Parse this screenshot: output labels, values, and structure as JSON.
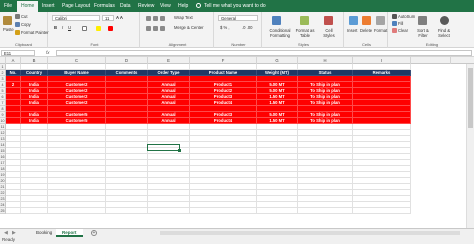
{
  "menu": {
    "tabs": [
      "File",
      "Home",
      "Insert",
      "Page Layout",
      "Formulas",
      "Data",
      "Review",
      "View",
      "Help"
    ],
    "active_index": 1,
    "tell_me": "Tell me what you want to do"
  },
  "ribbon": {
    "clipboard": {
      "paste": "Paste",
      "cut": "Cut",
      "copy": "Copy",
      "format_painter": "Format Painter",
      "label": "Clipboard"
    },
    "font": {
      "name": "Calibri",
      "size": "11",
      "label": "Font"
    },
    "alignment": {
      "wrap": "Wrap Text",
      "merge": "Merge & Center",
      "label": "Alignment"
    },
    "number": {
      "format": "General",
      "label": "Number"
    },
    "styles": {
      "conditional": "Conditional Formatting",
      "format_as": "Format as Table",
      "cell_styles": "Cell Styles",
      "label": "Styles"
    },
    "cells": {
      "insert": "Insert",
      "delete": "Delete",
      "format": "Format",
      "label": "Cells"
    },
    "editing": {
      "autosum": "AutoSum",
      "fill": "Fill",
      "clear": "Clear",
      "sort": "Sort & Filter",
      "find": "Find & Select",
      "label": "Editing"
    }
  },
  "formula_bar": {
    "name_box": "E11",
    "fx": "fx",
    "value": ""
  },
  "columns": [
    "A",
    "B",
    "C",
    "D",
    "E",
    "F",
    "G",
    "H",
    "I"
  ],
  "row_numbers": [
    "1",
    "2",
    "3",
    "4",
    "5",
    "6",
    "7",
    "8",
    "9",
    "10",
    "11",
    "12",
    "13",
    "14",
    "15",
    "16",
    "17",
    "18",
    "19",
    "20",
    "21",
    "22",
    "23",
    "24",
    "25"
  ],
  "table": {
    "headers": [
      "No.",
      "Country",
      "Buyer Name",
      "Comments",
      "Order Type",
      "Product Name",
      "Weight (MT)",
      "Status",
      "Remarks"
    ],
    "rows": [
      [
        "2",
        "India",
        "Customer2",
        "",
        "Annual",
        "Product1",
        "5.00 MT",
        "To Ship in plan",
        ""
      ],
      [
        "",
        "India",
        "Customer2",
        "",
        "Annual",
        "Product2",
        "5.00 MT",
        "To Ship in plan",
        ""
      ],
      [
        "",
        "India",
        "Customer2",
        "",
        "Annual",
        "Product3",
        "1.50 MT",
        "To Ship in plan",
        ""
      ],
      [
        "",
        "India",
        "Customer2",
        "",
        "Annual",
        "Product4",
        "1.50 MT",
        "To Ship in plan",
        ""
      ],
      [
        "",
        "India",
        "Customer5",
        "",
        "Annual",
        "Product3",
        "5.00 MT",
        "To Ship in plan",
        ""
      ],
      [
        "",
        "India",
        "Customer5",
        "",
        "Annual",
        "Product4",
        "1.50 MT",
        "To Ship in plan",
        ""
      ]
    ]
  },
  "sheets": {
    "tabs": [
      "Booking",
      "Report"
    ],
    "active_index": 1
  },
  "status": {
    "text": "Ready"
  },
  "colors": {
    "excel_green": "#217346",
    "header_blue": "#203864",
    "highlight_red": "#ff0000"
  }
}
